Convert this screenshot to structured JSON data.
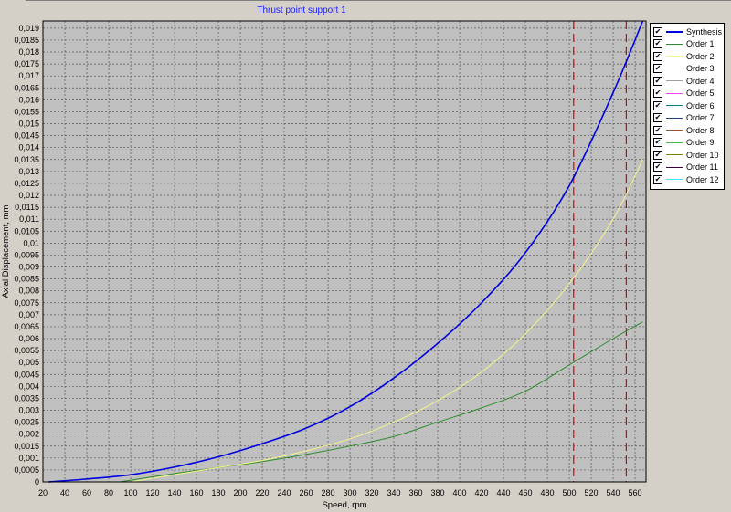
{
  "chart_data": {
    "type": "line",
    "title": "Thrust point support 1",
    "xlabel": "Speed, rpm",
    "ylabel": "Axial Displacement, mm",
    "xlim": [
      20,
      570
    ],
    "ylim": [
      0,
      0.0193
    ],
    "xticks": [
      "20",
      "40",
      "60",
      "80",
      "100",
      "120",
      "140",
      "160",
      "180",
      "200",
      "220",
      "240",
      "260",
      "280",
      "300",
      "320",
      "340",
      "360",
      "380",
      "400",
      "420",
      "440",
      "460",
      "480",
      "500",
      "520",
      "540",
      "560"
    ],
    "yticks": [
      "0",
      "0,0005",
      "0,001",
      "0,0015",
      "0,002",
      "0,0025",
      "0,003",
      "0,0035",
      "0,004",
      "0,0045",
      "0,005",
      "0,0055",
      "0,006",
      "0,0065",
      "0,007",
      "0,0075",
      "0,008",
      "0,0085",
      "0,009",
      "0,0095",
      "0,01",
      "0,0105",
      "0,011",
      "0,0115",
      "0,012",
      "0,0125",
      "0,013",
      "0,0135",
      "0,014",
      "0,0145",
      "0,015",
      "0,0155",
      "0,016",
      "0,0165",
      "0,017",
      "0,0175",
      "0,018",
      "0,0185",
      "0,019"
    ],
    "grid": true,
    "legend_position": "right",
    "series": [
      {
        "name": "Synthesis",
        "color": "#0000e0",
        "x": [
          25,
          60,
          100,
          140,
          180,
          220,
          260,
          300,
          340,
          380,
          420,
          460,
          500,
          540,
          567
        ],
        "y": [
          0,
          0.00012,
          0.0003,
          0.00062,
          0.00105,
          0.0016,
          0.00225,
          0.00315,
          0.00435,
          0.0058,
          0.0075,
          0.0096,
          0.0124,
          0.0163,
          0.0193
        ]
      },
      {
        "name": "Order 1",
        "color": "#2e8b2e",
        "x": [
          90,
          140,
          180,
          220,
          260,
          300,
          340,
          380,
          420,
          460,
          500,
          540,
          567
        ],
        "y": [
          0,
          0.00035,
          0.0006,
          0.00085,
          0.00115,
          0.0015,
          0.0019,
          0.0025,
          0.0031,
          0.0038,
          0.0049,
          0.006,
          0.0067
        ]
      },
      {
        "name": "Order 2",
        "color": "#f4f48a",
        "x": [
          100,
          140,
          180,
          220,
          260,
          300,
          340,
          380,
          420,
          460,
          500,
          540,
          567
        ],
        "y": [
          0,
          0.0003,
          0.0006,
          0.0009,
          0.0013,
          0.0018,
          0.0025,
          0.0034,
          0.0046,
          0.0062,
          0.0083,
          0.011,
          0.0135
        ]
      },
      {
        "name": "Order 3",
        "color": "#ffffff",
        "x": [],
        "y": []
      },
      {
        "name": "Order 4",
        "color": "#a0a0a0",
        "x": [],
        "y": []
      },
      {
        "name": "Order 5",
        "color": "#ff40ff",
        "x": [],
        "y": []
      },
      {
        "name": "Order 6",
        "color": "#008080",
        "x": [],
        "y": []
      },
      {
        "name": "Order 7",
        "color": "#204080",
        "x": [],
        "y": []
      },
      {
        "name": "Order 8",
        "color": "#a05020",
        "x": [],
        "y": []
      },
      {
        "name": "Order 9",
        "color": "#40c040",
        "x": [],
        "y": []
      },
      {
        "name": "Order 10",
        "color": "#808000",
        "x": [],
        "y": []
      },
      {
        "name": "Order 11",
        "color": "#400040",
        "x": [],
        "y": []
      },
      {
        "name": "Order 12",
        "color": "#40e0ff",
        "x": [],
        "y": []
      }
    ],
    "vertical_markers": [
      {
        "x": 504,
        "color": "#e00000"
      },
      {
        "x": 552,
        "color": "#e00000"
      }
    ],
    "plot_background": "#c0c0c0"
  }
}
